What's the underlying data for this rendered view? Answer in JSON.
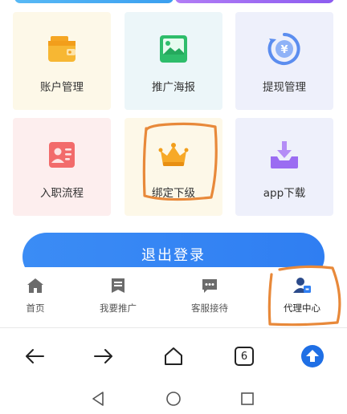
{
  "grid": {
    "items": [
      {
        "label": "账户管理",
        "icon": "wallet-icon"
      },
      {
        "label": "推广海报",
        "icon": "poster-icon"
      },
      {
        "label": "提现管理",
        "icon": "withdraw-icon"
      },
      {
        "label": "入职流程",
        "icon": "id-card-icon"
      },
      {
        "label": "绑定下级",
        "icon": "crown-bag-icon"
      },
      {
        "label": "app下载",
        "icon": "download-icon"
      }
    ]
  },
  "logout_button": {
    "label": "退出登录"
  },
  "tabbar": {
    "items": [
      {
        "label": "首页",
        "icon": "home-icon"
      },
      {
        "label": "我要推广",
        "icon": "promote-icon"
      },
      {
        "label": "客服接待",
        "icon": "chat-icon"
      },
      {
        "label": "代理中心",
        "icon": "agent-user-icon",
        "active": true
      }
    ]
  },
  "browser_nav": {
    "tab_count": "6",
    "icons": [
      "back-arrow-icon",
      "forward-arrow-icon",
      "home-outline-icon",
      "tabs-counter-icon",
      "upload-icon"
    ]
  },
  "system_nav": {
    "icons": [
      "system-back-icon",
      "system-home-icon",
      "system-recents-icon"
    ]
  },
  "colors": {
    "accent_blue": "#2f7ef2",
    "annotation_orange": "#e8893a"
  }
}
